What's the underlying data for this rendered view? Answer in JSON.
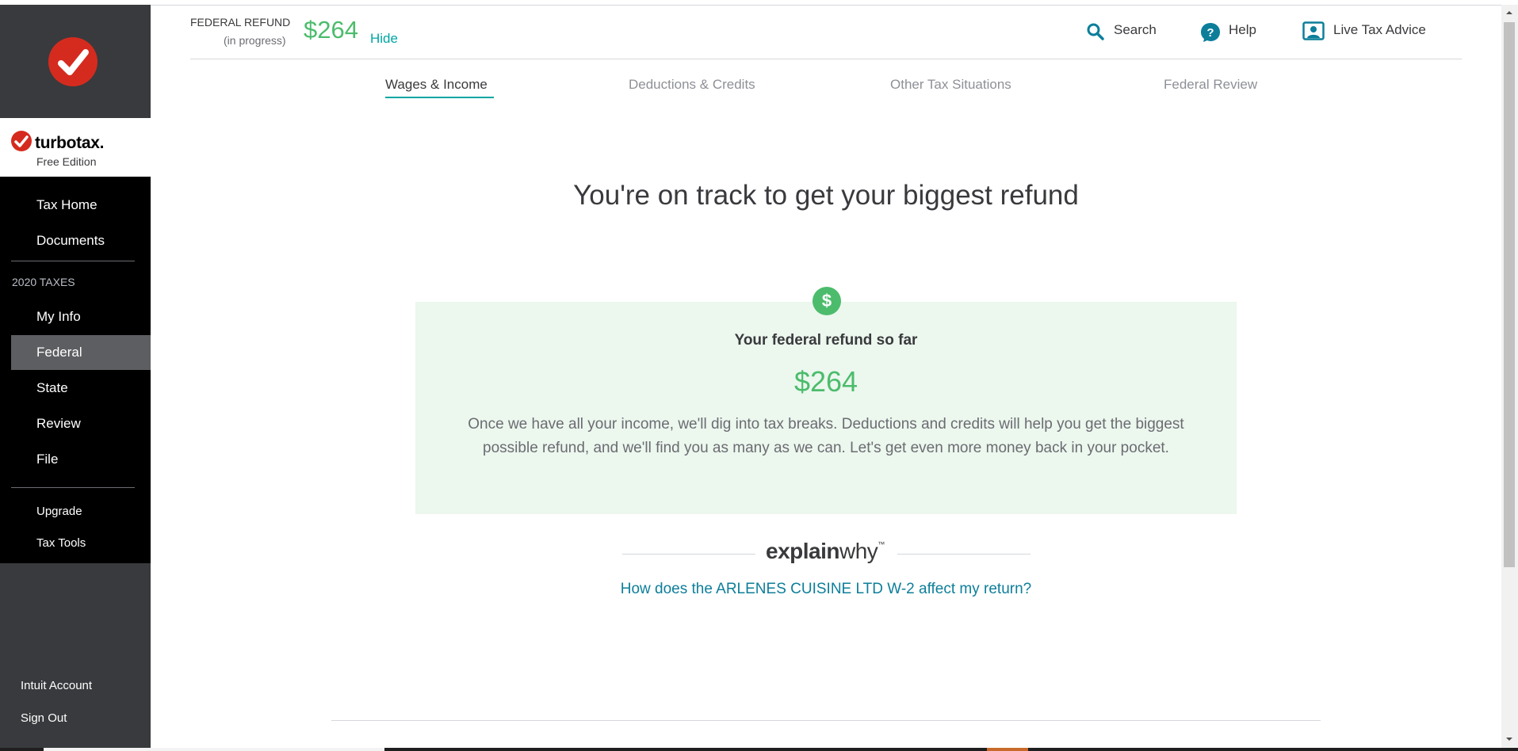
{
  "header": {
    "refund_label": "FEDERAL REFUND",
    "refund_sub": "(in progress)",
    "refund_amount": "$264",
    "hide_label": "Hide",
    "search_label": "Search",
    "help_label": "Help",
    "live_advice_label": "Live Tax Advice"
  },
  "tabs": [
    {
      "label": "Wages & Income",
      "active": true
    },
    {
      "label": "Deductions & Credits",
      "active": false
    },
    {
      "label": "Other Tax Situations",
      "active": false
    },
    {
      "label": "Federal Review",
      "active": false
    }
  ],
  "sidebar": {
    "brand_name": "turbotax.",
    "brand_edition": "Free Edition",
    "primary": [
      {
        "label": "Tax Home"
      },
      {
        "label": "Documents"
      }
    ],
    "section_label": "2020 TAXES",
    "tax_steps": [
      {
        "label": "My Info",
        "active": false
      },
      {
        "label": "Federal",
        "active": true
      },
      {
        "label": "State",
        "active": false
      },
      {
        "label": "Review",
        "active": false
      },
      {
        "label": "File",
        "active": false
      }
    ],
    "upgrade_label": "Upgrade",
    "tax_tools_label": "Tax Tools",
    "intuit_account_label": "Intuit Account",
    "sign_out_label": "Sign Out"
  },
  "main": {
    "headline": "You're on track to get your biggest refund",
    "card_title": "Your federal refund so far",
    "card_amount": "$264",
    "card_body": "Once we have all your income, we'll dig into tax breaks. Deductions and credits will help you get the biggest possible refund, and we'll find you as many as we can. Let's get even more money back in your pocket.",
    "explainwhy_bold": "explain",
    "explainwhy_light": "why",
    "explainwhy_tm": "™",
    "explainwhy_link": "How does the ARLENES CUISINE LTD W-2 affect my return?",
    "dollar_glyph": "$"
  },
  "colors": {
    "accent_teal": "#00a6a4",
    "refund_green": "#4cbc6c",
    "brand_red": "#d52b1e",
    "card_bg": "#ecf7ee",
    "link": "#0d7e9a"
  }
}
